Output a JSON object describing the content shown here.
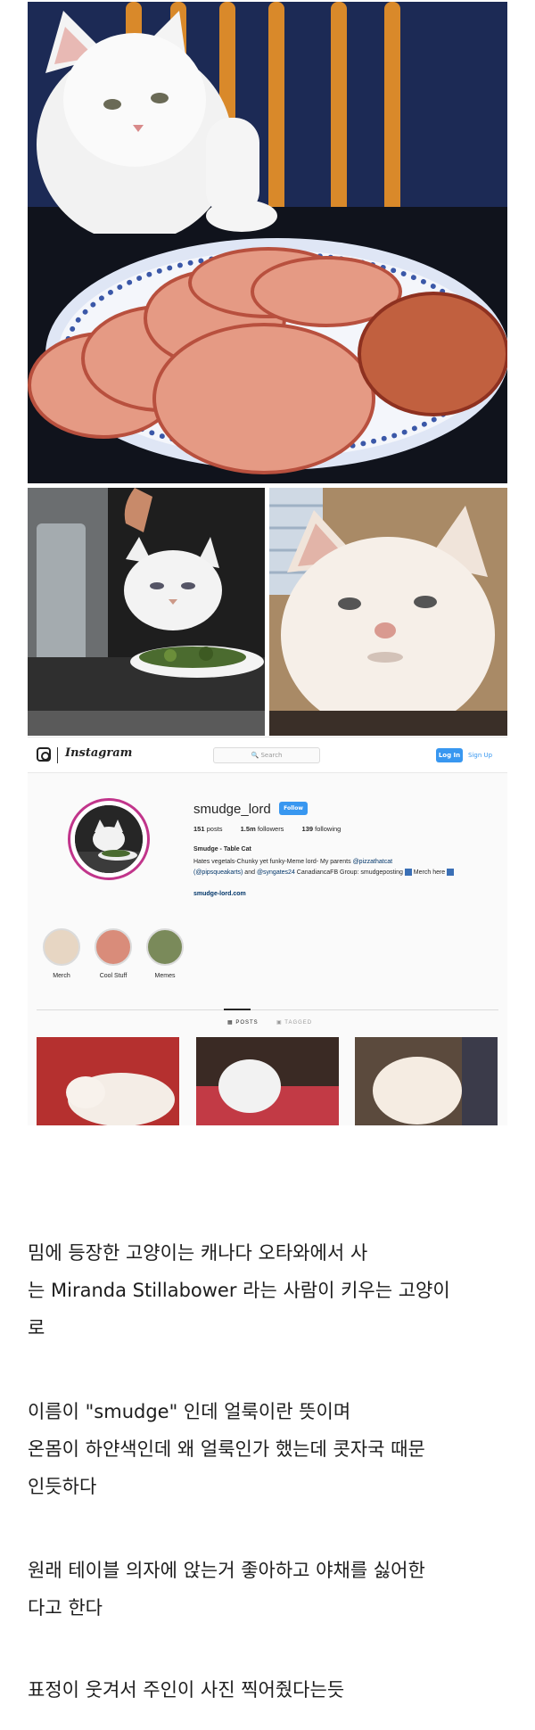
{
  "instagram": {
    "logo_text": "Instagram",
    "search_placeholder": "Search",
    "login_label": "Log In",
    "signup_label": "Sign Up",
    "username": "smudge_lord",
    "follow_label": "Follow",
    "stats": {
      "posts": "151",
      "posts_label": "posts",
      "followers": "1.5m",
      "followers_label": "followers",
      "following": "139",
      "following_label": "following"
    },
    "bio_name": "Smudge - Table Cat",
    "bio_line1_prefix": "Hates vegetals-Chunky yet funky-Meme lord- My parents ",
    "bio_link1": "@pizzathatcat",
    "bio_line2_link": "(@pipsqueakarts)",
    "bio_line2_middle": " and ",
    "bio_link3": "@syngates24",
    "bio_line2_suffix": " CanadiancaFB Group: smudgeposting",
    "bio_merch": "Merch here",
    "website": "smudge-lord.com",
    "highlights": [
      "Merch",
      "Cool Stuff",
      "Memes"
    ],
    "tabs": {
      "posts": "POSTS",
      "tagged": "TAGGED"
    }
  },
  "article": {
    "paragraphs": [
      [
        "밈에 등장한 고양이는 캐나다 오타와에서 사",
        "는 Miranda Stillabower 라는 사람이 키우는 고양이",
        "로"
      ],
      [
        "이름이 \"smudge\" 인데 얼룩이란 뜻이며",
        "온몸이 하얀색인데 왜 얼룩인가 했는데 콧자국 때문",
        "인듯하다"
      ],
      [
        "원래 테이블 의자에 앉는거 좋아하고 야채를 싫어한",
        "다고 한다"
      ],
      [
        "표정이 웃겨서 주인이 사진 찍어줬다는듯"
      ]
    ]
  },
  "colors": {
    "instagram_blue": "#3897f0",
    "link_dark_blue": "#003569",
    "avatar_ring": "#c1358b"
  }
}
